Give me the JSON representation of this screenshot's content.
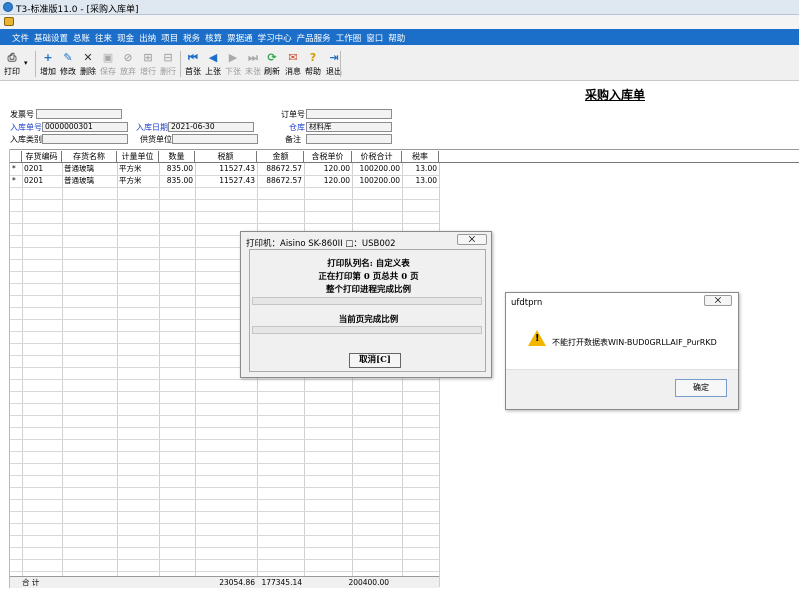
{
  "window": {
    "title": "T3-标准版11.0 - [采购入库单]"
  },
  "menu": [
    "文件",
    "基础设置",
    "总账",
    "往来",
    "现金",
    "出纳",
    "项目",
    "税务",
    "核算",
    "票据通",
    "学习中心",
    "产品服务",
    "工作圈",
    "窗口",
    "帮助"
  ],
  "toolbar": [
    {
      "label": "打印",
      "icon": "printer-icon",
      "enabled": true
    },
    {
      "label": "增加",
      "icon": "add-icon",
      "enabled": true
    },
    {
      "label": "修改",
      "icon": "edit-icon",
      "enabled": true
    },
    {
      "label": "删除",
      "icon": "delete-icon",
      "enabled": true
    },
    {
      "label": "保存",
      "icon": "save-icon",
      "enabled": false
    },
    {
      "label": "放弃",
      "icon": "discard-icon",
      "enabled": false
    },
    {
      "label": "增行",
      "icon": "add-row-icon",
      "enabled": false
    },
    {
      "label": "删行",
      "icon": "delete-row-icon",
      "enabled": false
    },
    {
      "label": "首张",
      "icon": "first-icon",
      "enabled": true
    },
    {
      "label": "上张",
      "icon": "prev-icon",
      "enabled": true
    },
    {
      "label": "下张",
      "icon": "next-icon",
      "enabled": false
    },
    {
      "label": "末张",
      "icon": "last-icon",
      "enabled": false
    },
    {
      "label": "刷新",
      "icon": "refresh-icon",
      "enabled": true
    },
    {
      "label": "消息",
      "icon": "message-icon",
      "enabled": true
    },
    {
      "label": "帮助",
      "icon": "help-icon",
      "enabled": true
    },
    {
      "label": "退出",
      "icon": "exit-icon",
      "enabled": true
    }
  ],
  "form": {
    "title": "采购入库单",
    "invoice_no_label": "发票号",
    "invoice_no": "",
    "receipt_no_label": "入库单号",
    "receipt_no": "0000000301",
    "receipt_date_label": "入库日期",
    "receipt_date": "2021-06-30",
    "order_no_label": "订单号",
    "order_no": "",
    "warehouse_label": "仓库",
    "warehouse": "材料库",
    "category_label": "入库类别",
    "category": "",
    "supplier_label": "供货单位",
    "supplier": "",
    "remark_label": "备注",
    "remark": ""
  },
  "grid": {
    "headers": [
      "存货编码",
      "存货名称",
      "计量单位",
      "数量",
      "税额",
      "金额",
      "含税单价",
      "价税合计",
      "税率"
    ],
    "rows": [
      [
        "0201",
        "普通玻璃",
        "平方米",
        "835.00",
        "11527.43",
        "88672.57",
        "120.00",
        "100200.00",
        "13.00"
      ],
      [
        "0201",
        "普通玻璃",
        "平方米",
        "835.00",
        "11527.43",
        "88672.57",
        "120.00",
        "100200.00",
        "13.00"
      ]
    ],
    "row_marker": "*",
    "total_label": "合  计",
    "total_tax": "23054.86",
    "total_amount": "177345.14",
    "total_sum": "200400.00"
  },
  "print_dialog": {
    "title": "打印机：Aisino SK-860II  □：USB002",
    "close": "⨉",
    "queue": "打印队列名: 自定义表",
    "progress": "正在打印第   0 页总共   0 页",
    "overall_label": "整个打印进程完成比例",
    "page_label": "当前页完成比例",
    "cancel": "取消[C]",
    "overall_progress": 0,
    "page_progress": 0
  },
  "error_dialog": {
    "title": "ufdtprn",
    "close": "⨉",
    "message": "不能打开数据表WIN-BUD0GRLLAIF_PurRKD",
    "ok": "确定"
  }
}
